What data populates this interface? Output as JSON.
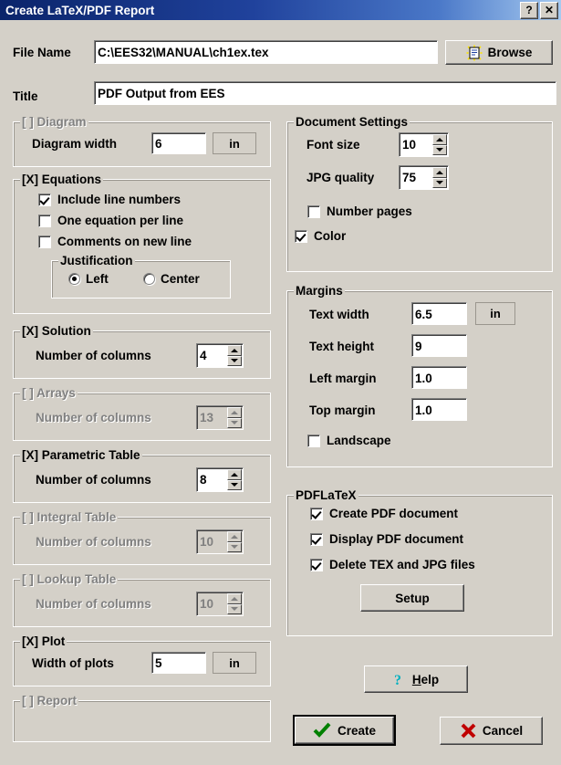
{
  "window": {
    "title": "Create LaTeX/PDF Report",
    "help_button": "?",
    "close_button": "✕"
  },
  "top_fields": {
    "file_name_label": "File Name",
    "file_name_value": "C:\\EES32\\MANUAL\\ch1ex.tex",
    "title_label": "Title",
    "title_value": "PDF Output from EES",
    "browse_label": "Browse"
  },
  "left_column": {
    "diagram": {
      "caption": "[ ] Diagram",
      "checked": false,
      "enabled": false,
      "width_label": "Diagram width",
      "width_value": "6",
      "unit": "in"
    },
    "equations": {
      "caption": "[X] Equations",
      "checked": true,
      "enabled": true,
      "options": [
        {
          "label": "Include line numbers",
          "checked": true
        },
        {
          "label": "One equation per line",
          "checked": false
        },
        {
          "label": "Comments on new line",
          "checked": false
        }
      ],
      "justification": {
        "caption": "Justification",
        "options": [
          {
            "label": "Left",
            "selected": true
          },
          {
            "label": "Center",
            "selected": false
          }
        ]
      }
    },
    "solution": {
      "caption": "[X] Solution",
      "enabled": true,
      "columns_label": "Number of columns",
      "columns_value": "4"
    },
    "arrays": {
      "caption": "[ ] Arrays",
      "enabled": false,
      "columns_label": "Number of columns",
      "columns_value": "13"
    },
    "parametric_table": {
      "caption": "[X] Parametric Table",
      "enabled": true,
      "columns_label": "Number of columns",
      "columns_value": "8"
    },
    "integral_table": {
      "caption": "[ ] Integral Table",
      "enabled": false,
      "columns_label": "Number of columns",
      "columns_value": "10"
    },
    "lookup_table": {
      "caption": "[ ] Lookup Table",
      "enabled": false,
      "columns_label": "Number of columns",
      "columns_value": "10"
    },
    "plot": {
      "caption": "[X] Plot",
      "enabled": true,
      "width_label": "Width of plots",
      "width_value": "5",
      "unit": "in"
    },
    "report": {
      "caption": "[ ] Report",
      "enabled": false
    }
  },
  "right_column": {
    "document_settings": {
      "caption": "Document Settings",
      "font_size_label": "Font size",
      "font_size_value": "10",
      "jpg_quality_label": "JPG quality",
      "jpg_quality_value": "75",
      "number_pages_label": "Number pages",
      "number_pages_checked": false,
      "color_label": "Color",
      "color_checked": true
    },
    "margins": {
      "caption": "Margins",
      "unit": "in",
      "fields": [
        {
          "label": "Text width",
          "value": "6.5"
        },
        {
          "label": "Text height",
          "value": "9"
        },
        {
          "label": "Left margin",
          "value": "1.0"
        },
        {
          "label": "Top margin",
          "value": "1.0"
        }
      ],
      "landscape_label": "Landscape",
      "landscape_checked": false
    },
    "pdflatex": {
      "caption": "PDFLaTeX",
      "options": [
        {
          "label": "Create PDF document",
          "checked": true
        },
        {
          "label": "Display PDF document",
          "checked": true
        },
        {
          "label": "Delete TEX and JPG files",
          "checked": true
        }
      ],
      "setup_label": "Setup"
    }
  },
  "actions": {
    "help_label": "Help",
    "help_accel": "H",
    "help_prefix": "",
    "create_label": "Create",
    "cancel_label": "Cancel"
  },
  "colors": {
    "dialog_face": "#d4d0c8",
    "title_left": "#0a246a",
    "title_right": "#a6caf0",
    "disabled_text": "#808080",
    "check_green": "#008000",
    "cancel_red": "#c00000",
    "help_cyan": "#00b0c0"
  }
}
